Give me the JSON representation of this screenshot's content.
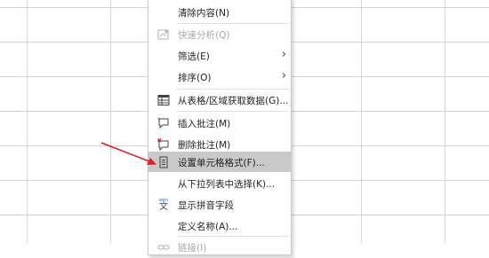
{
  "menu": {
    "items": [
      {
        "label": "清除内容(N)",
        "icon": "",
        "disabled": false
      },
      {
        "label": "快速分析(Q)",
        "icon": "quick-analysis-icon",
        "disabled": true
      },
      {
        "label": "筛选(E)",
        "icon": "",
        "disabled": false,
        "submenu": true
      },
      {
        "label": "排序(O)",
        "icon": "",
        "disabled": false,
        "submenu": true
      },
      {
        "label": "从表格/区域获取数据(G)...",
        "icon": "table-icon",
        "disabled": false
      },
      {
        "label": "插入批注(M)",
        "icon": "insert-comment-icon",
        "disabled": false
      },
      {
        "label": "删除批注(M)",
        "icon": "delete-comment-icon",
        "disabled": false
      },
      {
        "label": "设置单元格格式(F)...",
        "icon": "format-cells-icon",
        "disabled": false,
        "highlighted": true
      },
      {
        "label": "从下拉列表中选择(K)...",
        "icon": "",
        "disabled": false
      },
      {
        "label": "显示拼音字段",
        "icon": "phonetic-icon",
        "disabled": false
      },
      {
        "label": "定义名称(A)...",
        "icon": "",
        "disabled": false
      },
      {
        "label": "链接(I)",
        "icon": "link-icon",
        "disabled": true
      }
    ],
    "phonetic_glyph": "文",
    "phonetic_small": "wén",
    "submenu_arrow": "›"
  },
  "colors": {
    "annotation_arrow": "#e02020",
    "highlight": "#c9c9c9",
    "grid": "#d4d4d4"
  }
}
